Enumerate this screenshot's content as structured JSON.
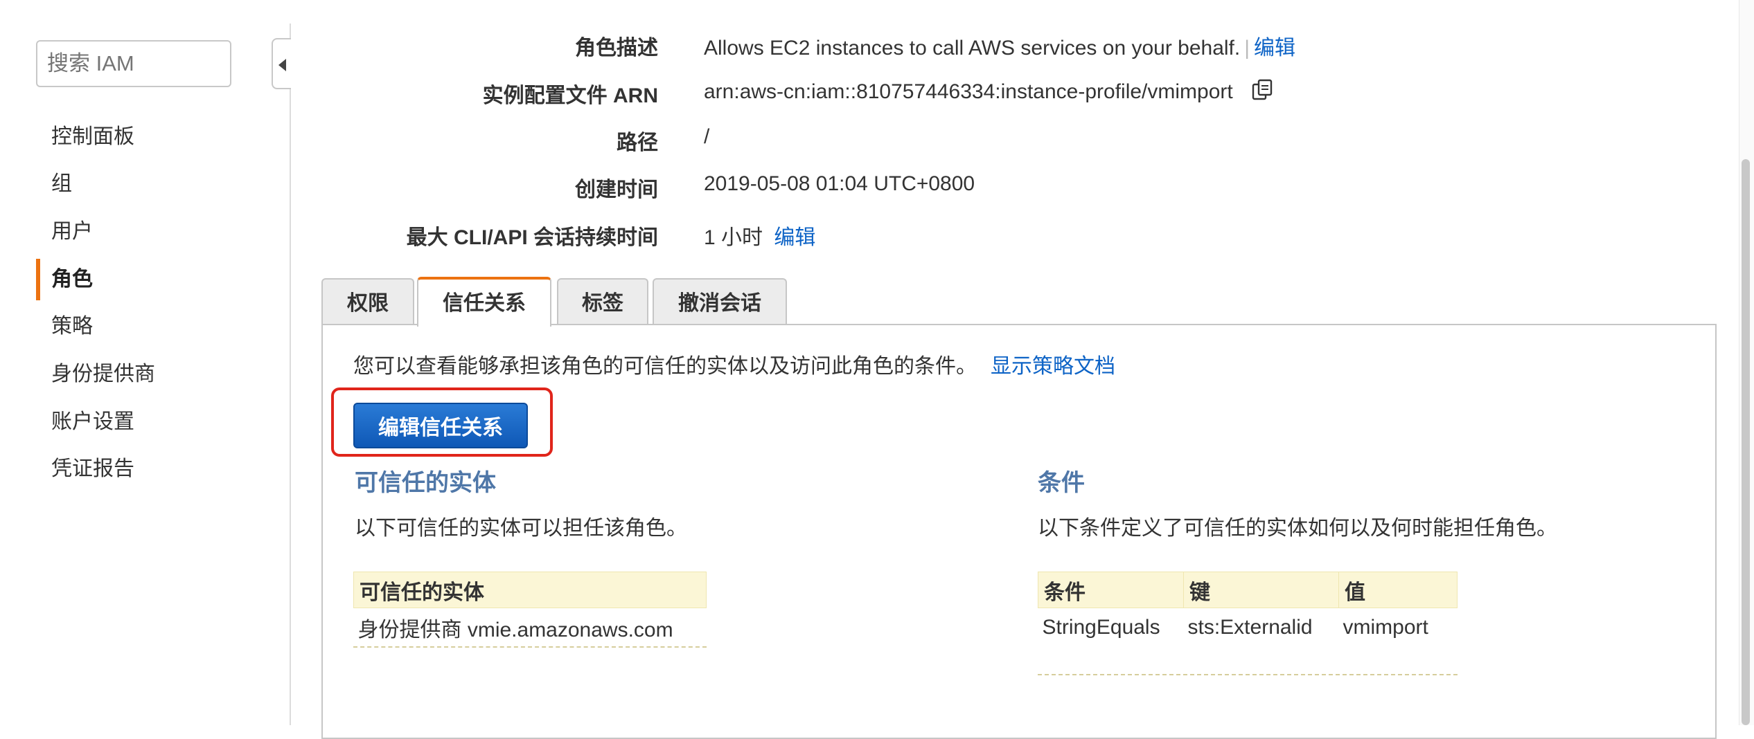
{
  "sidebar": {
    "search_placeholder": "搜索 IAM",
    "items": [
      {
        "label": "控制面板"
      },
      {
        "label": "组"
      },
      {
        "label": "用户"
      },
      {
        "label": "角色",
        "active": true
      },
      {
        "label": "策略"
      },
      {
        "label": "身份提供商"
      },
      {
        "label": "账户设置"
      },
      {
        "label": "凭证报告"
      }
    ]
  },
  "summary": {
    "description": {
      "label": "角色描述",
      "value": "Allows EC2 instances to call AWS services on your behalf.",
      "separator": "|",
      "edit": "编辑"
    },
    "instance_profile_arn": {
      "label": "实例配置文件 ARN",
      "value": "arn:aws-cn:iam::810757446334:instance-profile/vmimport"
    },
    "path": {
      "label": "路径",
      "value": "/"
    },
    "creation_time": {
      "label": "创建时间",
      "value": "2019-05-08 01:04 UTC+0800"
    },
    "max_session": {
      "label": "最大 CLI/API 会话持续时间",
      "value": "1 小时",
      "edit": "编辑"
    }
  },
  "tabs": [
    {
      "label": "权限"
    },
    {
      "label": "信任关系",
      "active": true
    },
    {
      "label": "标签"
    },
    {
      "label": "撤消会话"
    }
  ],
  "trust": {
    "description": "您可以查看能够承担该角色的可信任的实体以及访问此角色的条件。",
    "show_policy_link": "显示策略文档",
    "edit_button": "编辑信任关系",
    "entities": {
      "title": "可信任的实体",
      "description": "以下可信任的实体可以担任该角色。",
      "header": "可信任的实体",
      "rows": [
        "身份提供商 vmie.amazonaws.com"
      ]
    },
    "conditions": {
      "title": "条件",
      "description": "以下条件定义了可信任的实体如何以及何时能担任角色。",
      "headers": [
        "条件",
        "键",
        "值"
      ],
      "rows": [
        [
          "StringEquals",
          "sts:Externalid",
          "vmimport"
        ]
      ]
    }
  },
  "colors": {
    "accent": "#ec7211",
    "link": "#0d63c6",
    "primary_button": "#1a66c4",
    "highlight": "#e0251b",
    "table_header": "#fbf6d6"
  },
  "icons": {
    "copy": "copy-icon",
    "collapse": "chevron-left-icon"
  }
}
